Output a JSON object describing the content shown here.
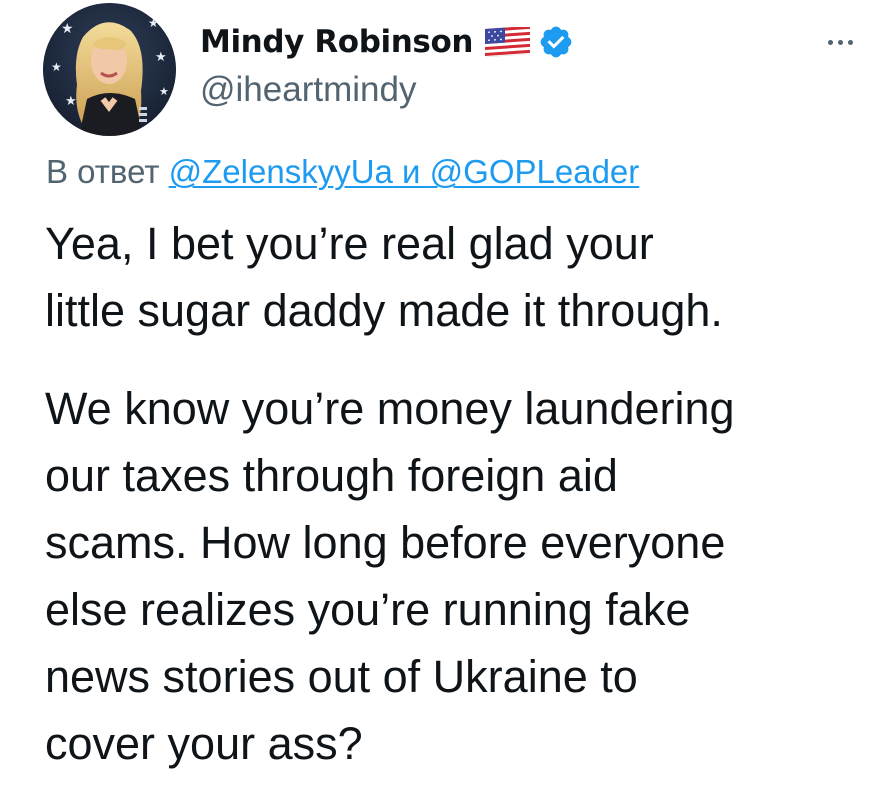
{
  "author": {
    "display_name": "Mindy Robinson",
    "handle": "@iheartmindy",
    "avatar_icon": "profile-photo",
    "flag_icon": "us-flag-emoji",
    "verified_icon": "verified-badge",
    "verified_color": "#1d9bf0"
  },
  "menu": {
    "more_icon": "more-horizontal-icon"
  },
  "reply": {
    "prefix": "В ответ",
    "mention_1": "@ZelenskyyUa",
    "conjunction": "и",
    "mention_2": "@GOPLeader",
    "link_color": "#1d9bf0"
  },
  "tweet": {
    "paragraph_1": "Yea, I bet you’re real glad your\nlittle sugar daddy made it through.",
    "paragraph_2": "We know you’re money laundering\nour taxes through foreign aid\nscams. How long before everyone\nelse realizes you’re running fake\nnews stories out of Ukraine to\ncover your ass?"
  },
  "colors": {
    "text_primary": "#0f1419",
    "text_secondary": "#536471",
    "background": "#ffffff"
  }
}
